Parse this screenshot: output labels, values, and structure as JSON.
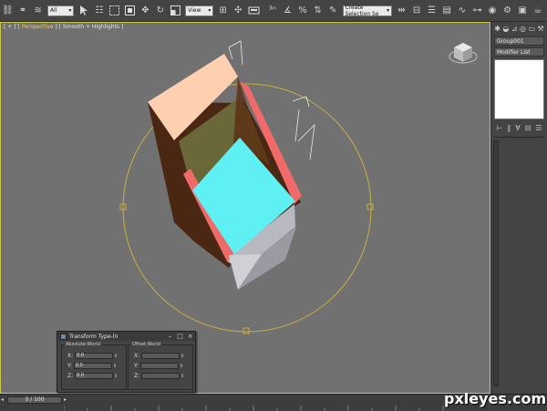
{
  "toolbar": {
    "filter_select": "All",
    "refcoord_select": "View",
    "selection_set": "Create Selection Se"
  },
  "viewport": {
    "label_prefix": "[ + ] [ ",
    "label_view": "Perspective",
    "label_mid": " ] [ ",
    "label_shading": "Smooth + Highlights",
    "label_suffix": " ]"
  },
  "command_panel": {
    "object_name": "Group001",
    "modifier_list": "Modifier List"
  },
  "transform_dialog": {
    "title": "Transform Type-In",
    "absolute_group": "Absolute:World",
    "offset_group": "Offset:World",
    "labels": [
      "X:",
      "Y:",
      "Z:"
    ],
    "absolute_values": [
      "0.0",
      "0.0",
      "0.0"
    ],
    "offset_values": [
      "",
      "",
      ""
    ]
  },
  "timeline": {
    "frame": "0 / 100"
  },
  "watermark": "pxleyes.com",
  "colors": {
    "viewport_bg": "#717171",
    "viewport_border": "#c9c94a",
    "gizmo_circle": "#c8b040",
    "peach": "#ffd0b0",
    "cyan": "#5ff0f4",
    "red": "#f06a6a",
    "brown": "#4a2712"
  }
}
